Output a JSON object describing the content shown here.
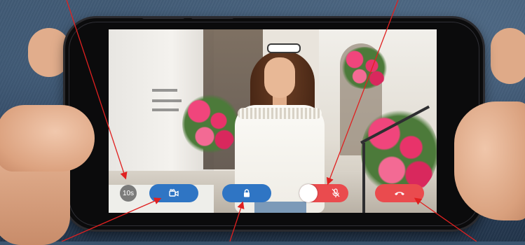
{
  "controls": {
    "timer_label": "10s",
    "record_icon": "video-camera-icon",
    "unlock_icon": "unlock-icon",
    "mic_icon": "mic-muted-icon",
    "hangup_icon": "phone-hangup-icon",
    "mic_toggle_state": "off"
  },
  "colors": {
    "primary_blue": "#2f75c4",
    "danger_red": "#ea4b4e",
    "timer_gray": "#6e6e6e",
    "callout_red": "#e02020"
  }
}
